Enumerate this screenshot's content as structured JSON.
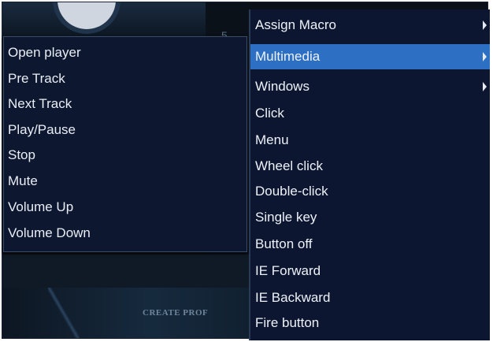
{
  "background": {
    "create_profile_text": "CREATE PROF",
    "stray_char": "5"
  },
  "submenu": {
    "items": [
      {
        "label": "Open player"
      },
      {
        "label": "Pre Track"
      },
      {
        "label": "Next Track"
      },
      {
        "label": "Play/Pause"
      },
      {
        "label": "Stop"
      },
      {
        "label": "Mute"
      },
      {
        "label": "Volume Up"
      },
      {
        "label": "Volume Down"
      }
    ]
  },
  "menu": {
    "items": [
      {
        "label": "Assign Macro",
        "has_submenu": true
      },
      {
        "label": "Multimedia",
        "has_submenu": true,
        "highlighted": true
      },
      {
        "label": "Windows",
        "has_submenu": true
      },
      {
        "label": "Click"
      },
      {
        "label": "Menu"
      },
      {
        "label": "Wheel click"
      },
      {
        "label": "Double-click"
      },
      {
        "label": "Single key"
      },
      {
        "label": "Button off"
      },
      {
        "label": "IE Forward"
      },
      {
        "label": "IE Backward"
      },
      {
        "label": "Fire button"
      }
    ]
  },
  "colors": {
    "menu_bg": "#0c1630",
    "highlight": "#2d6fc3",
    "text": "#eef2f8"
  }
}
